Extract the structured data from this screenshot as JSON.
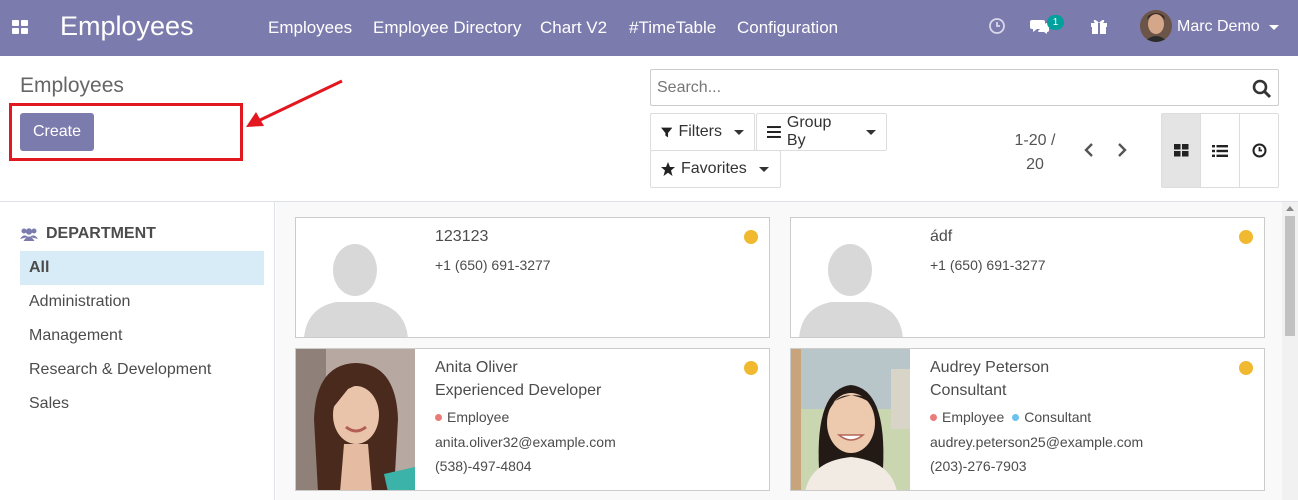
{
  "navbar": {
    "brand": "Employees",
    "menu": [
      "Employees",
      "Employee Directory",
      "Chart V2",
      "#TimeTable",
      "Configuration"
    ],
    "chat_count": "1",
    "user": "Marc Demo"
  },
  "control_panel": {
    "breadcrumb": "Employees",
    "create_label": "Create",
    "search_placeholder": "Search...",
    "filters_label": "Filters",
    "group_by_label": "Group By",
    "favorites_label": "Favorites",
    "pager_range": "1-20 /",
    "pager_total": "20",
    "views": [
      "kanban-view",
      "list-view",
      "activity-view"
    ]
  },
  "sidebar": {
    "title": "DEPARTMENT",
    "items": [
      {
        "label": "All",
        "active": true
      },
      {
        "label": "Administration"
      },
      {
        "label": "Management"
      },
      {
        "label": "Research & Development"
      },
      {
        "label": "Sales"
      }
    ]
  },
  "employees": [
    {
      "name": "123123",
      "phone": "+1 (650) 691-3277",
      "status_color": "#f0b92f",
      "photo": "placeholder"
    },
    {
      "name": "ádf",
      "phone": "+1 (650) 691-3277",
      "status_color": "#f0b92f",
      "photo": "placeholder"
    },
    {
      "name": "Anita Oliver",
      "job": "Experienced Developer",
      "tags": [
        {
          "label": "Employee",
          "color": "#e97c78"
        }
      ],
      "email": "anita.oliver32@example.com",
      "phone": "(538)-497-4804",
      "status_color": "#f0b92f",
      "photo": "anita"
    },
    {
      "name": "Audrey Peterson",
      "job": "Consultant",
      "tags": [
        {
          "label": "Employee",
          "color": "#e97c78"
        },
        {
          "label": "Consultant",
          "color": "#6cc1ed"
        }
      ],
      "email": "audrey.peterson25@example.com",
      "phone": "(203)-276-7903",
      "status_color": "#f0b92f",
      "photo": "audrey"
    }
  ],
  "colors": {
    "brand": "#7c7bad",
    "annotation": "#e3171f",
    "status": "#f0b92f"
  }
}
